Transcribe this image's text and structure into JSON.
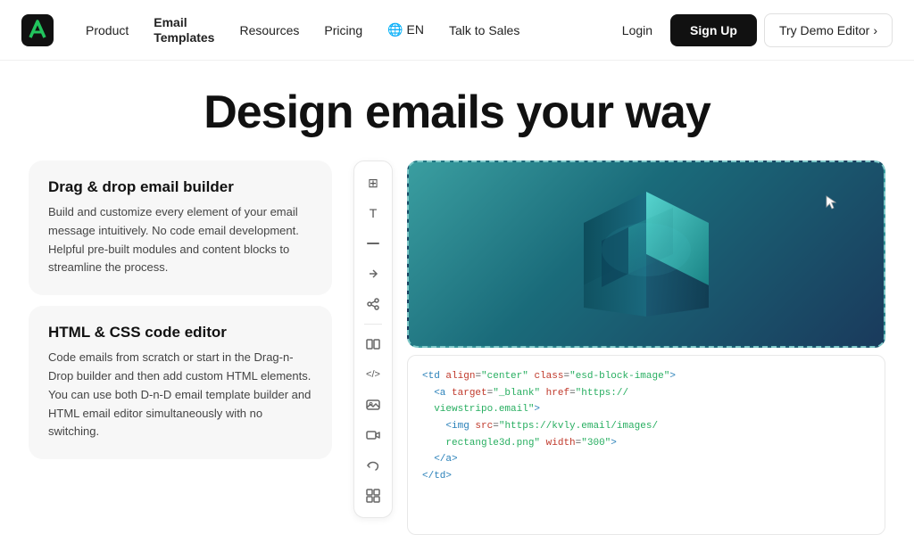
{
  "nav": {
    "logo_alt": "Stripo logo",
    "links": [
      {
        "id": "product",
        "label": "Product"
      },
      {
        "id": "email-templates",
        "label1": "Email",
        "label2": "Templates"
      },
      {
        "id": "resources",
        "label": "Resources"
      },
      {
        "id": "pricing",
        "label": "Pricing"
      },
      {
        "id": "language",
        "label": "🌐 EN"
      },
      {
        "id": "talk-to-sales",
        "label": "Talk to Sales"
      }
    ],
    "login_label": "Login",
    "signup_label": "Sign Up",
    "demo_label": "Try Demo Editor",
    "demo_arrow": "›"
  },
  "hero": {
    "title": "Design emails your way"
  },
  "features": [
    {
      "id": "drag-drop",
      "title": "Drag & drop email builder",
      "desc": "Build and customize every element of your email message intuitively. No code email development. Helpful pre-built modules and content blocks to streamline the process."
    },
    {
      "id": "html-css",
      "title": "HTML & CSS code editor",
      "desc": "Code emails from scratch or start in the Drag-n-Drop builder and then add custom HTML elements. You can use both D-n-D email template builder and HTML email editor simultaneously with no switching."
    }
  ],
  "toolbar_icons": [
    "⊞",
    "T",
    "⊟",
    "⇄",
    "∿",
    "≡",
    "</>",
    "🖼",
    "▶",
    "↺",
    "⊡"
  ],
  "code_lines": [
    "<td align=\"center\" class=\"esd-block-image\">",
    "  <a target=\"_blank\" href=\"https://",
    "  viewstripo.email\">",
    "    <img src=\"https://kvly.email/images/",
    "    rectangle3d.png\" width=\"300\">",
    "  </a>",
    "</td>"
  ],
  "colors": {
    "accent_green": "#22c55e",
    "nav_bg": "#ffffff",
    "card_bg": "#f7f7f7",
    "signup_bg": "#111111",
    "dashed_border": "#7ec8c8"
  }
}
